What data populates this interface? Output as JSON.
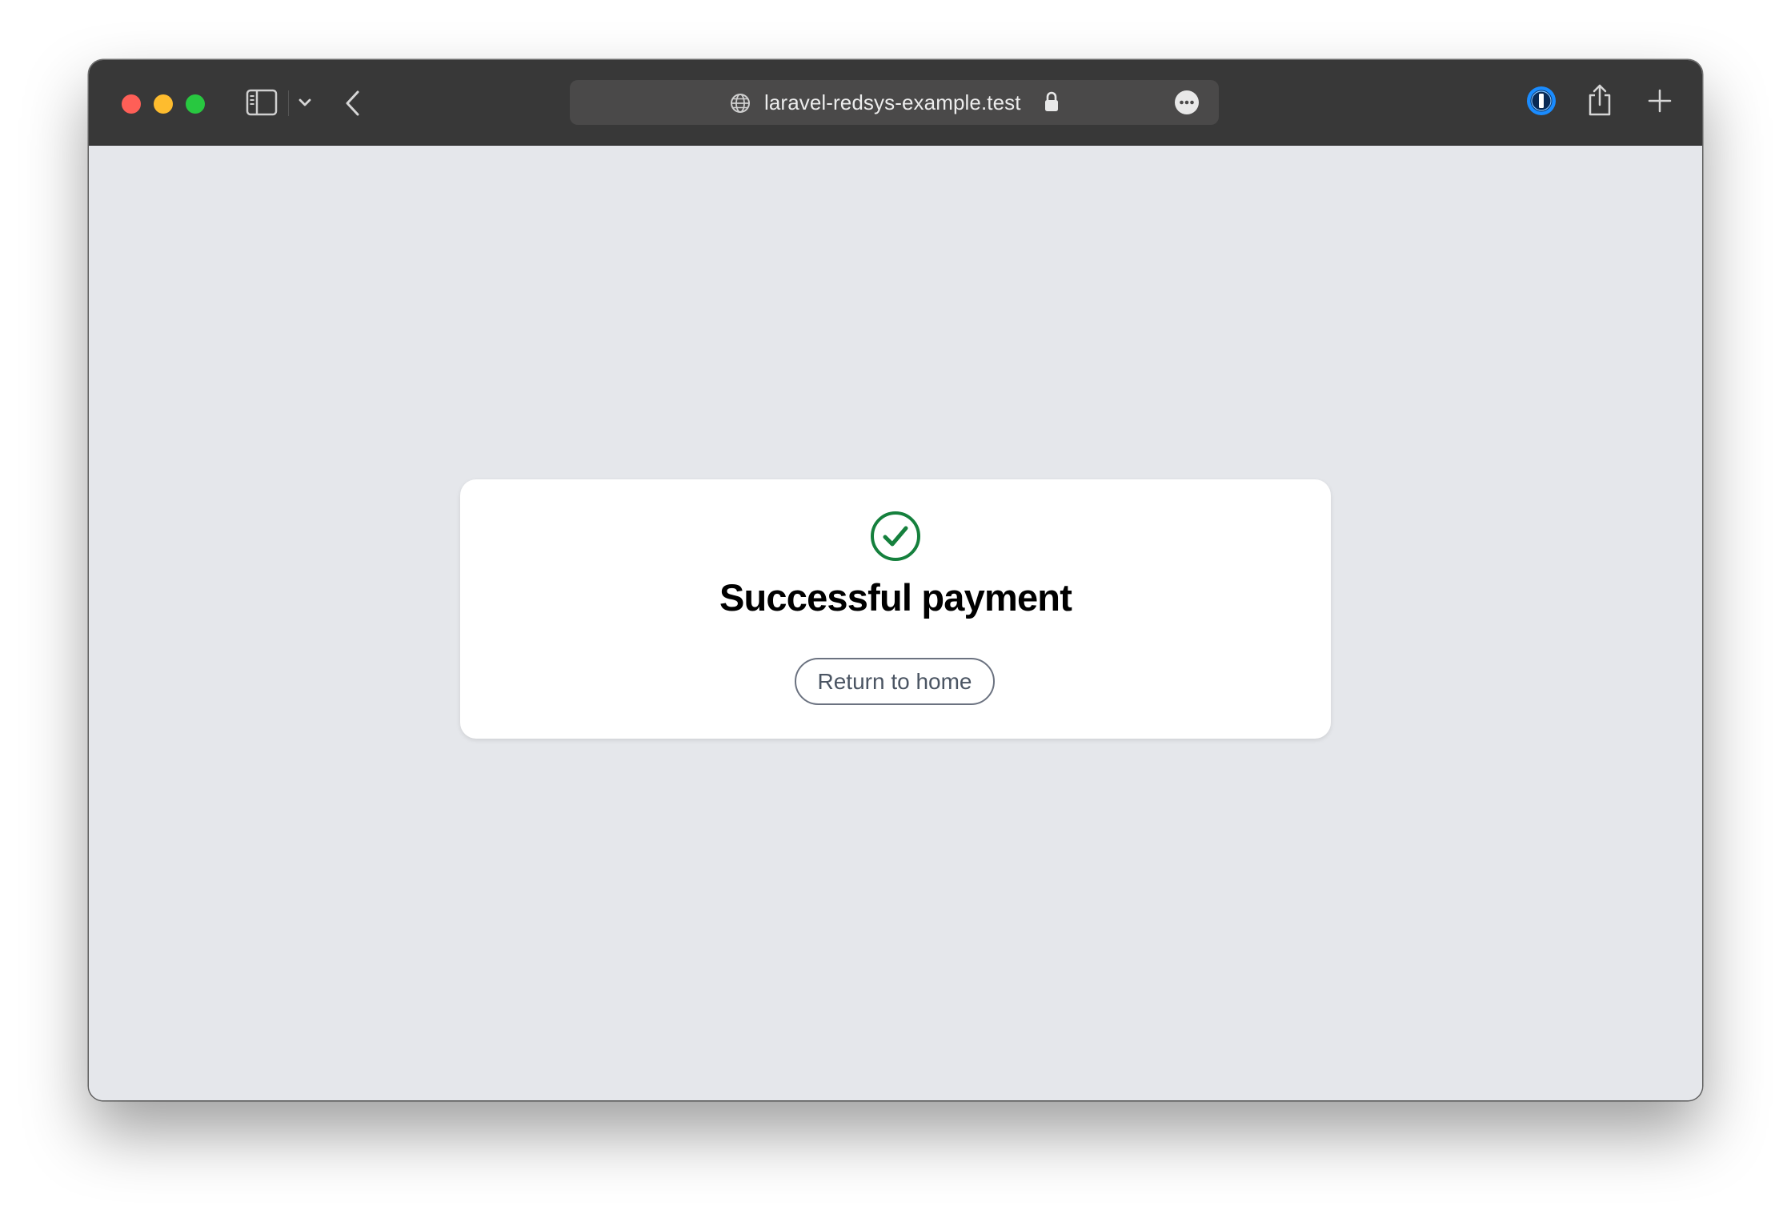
{
  "browser": {
    "url": "laravel-redsys-example.test",
    "icons": {
      "sidebar": "sidebar-icon",
      "chevron": "chevron-down-icon",
      "back": "back-arrow-icon",
      "globe": "globe-icon",
      "lock": "lock-icon",
      "more": "more-icon",
      "password_manager": "1password-icon",
      "share": "share-icon",
      "new_tab": "plus-icon"
    },
    "colors": {
      "titlebar": "#383838",
      "urlbar": "#4a4949",
      "close": "#fe5f57",
      "minimize": "#febc2e",
      "maximize": "#28c840"
    }
  },
  "page": {
    "background": "#e5e7eb",
    "card": {
      "icon": "check-circle-icon",
      "icon_color": "#15803d",
      "title": "Successful payment",
      "button_label": "Return to home"
    }
  }
}
